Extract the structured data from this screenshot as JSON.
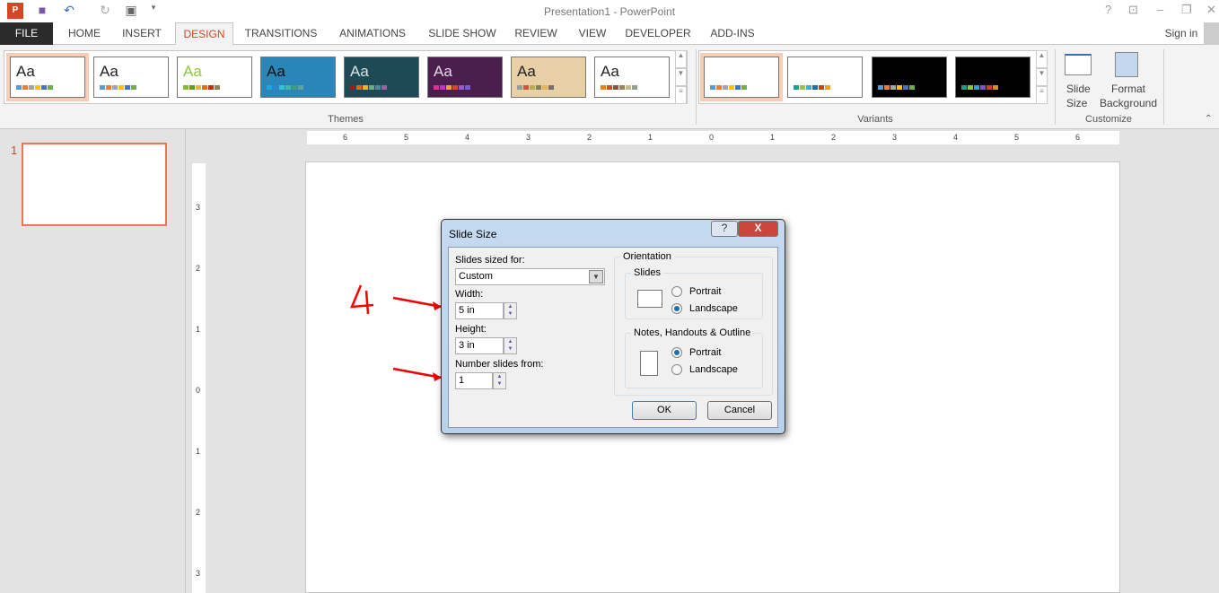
{
  "app": {
    "title": "Presentation1 - PowerPoint",
    "sign_in": "Sign in"
  },
  "tabs": [
    "FILE",
    "HOME",
    "INSERT",
    "DESIGN",
    "TRANSITIONS",
    "ANIMATIONS",
    "SLIDE SHOW",
    "REVIEW",
    "VIEW",
    "DEVELOPER",
    "ADD-INS"
  ],
  "active_tab": "DESIGN",
  "ribbon": {
    "themes_label": "Themes",
    "variants_label": "Variants",
    "customize_label": "Customize",
    "theme_sample": "Aa",
    "slide_size": "Slide Size",
    "slide_size_line1": "Slide",
    "slide_size_line2": "Size",
    "format_bg_line1": "Format",
    "format_bg_line2": "Background"
  },
  "themes": [
    {
      "bg": "#ffffff",
      "fg": "#222",
      "colors": [
        "#5b9bd5",
        "#ed7d31",
        "#a5a5a5",
        "#ffc000",
        "#4472c4",
        "#70ad47"
      ]
    },
    {
      "bg": "#ffffff",
      "fg": "#222",
      "colors": [
        "#5b9bd5",
        "#ed7d31",
        "#a5a5a5",
        "#ffc000",
        "#4472c4",
        "#70ad47"
      ]
    },
    {
      "bg": "#ffffff",
      "fg": "#8dc63f",
      "colors": [
        "#8ab833",
        "#5f9d2b",
        "#e6b91e",
        "#e76618",
        "#c42f1a",
        "#918655"
      ]
    },
    {
      "bg": "#2a86b8",
      "fg": "#111",
      "colors": [
        "#1ca5e0",
        "#2b88c8",
        "#33c3d9",
        "#47b5a5",
        "#3f9f7c",
        "#62a39f"
      ]
    },
    {
      "bg": "#1d4a55",
      "fg": "#d8e6e8",
      "colors": [
        "#b01513",
        "#ea6312",
        "#e6b729",
        "#6bab90",
        "#55839a",
        "#9e5e9b"
      ]
    },
    {
      "bg": "#4a1f4e",
      "fg": "#e8d8ea",
      "colors": [
        "#e32d91",
        "#c830cc",
        "#f0a22e",
        "#d3472b",
        "#9b57d3",
        "#755dd9"
      ]
    },
    {
      "bg": "#e8cfa6",
      "fg": "#222",
      "colors": [
        "#93a299",
        "#cf543f",
        "#b5ae53",
        "#848058",
        "#e8b54d",
        "#786c71"
      ]
    },
    {
      "bg": "#ffffff",
      "fg": "#222",
      "colors": [
        "#e48312",
        "#bd582c",
        "#865640",
        "#9b8357",
        "#c2bc80",
        "#94a088"
      ]
    }
  ],
  "variants": [
    {
      "bg": "#ffffff",
      "colors": [
        "#5b9bd5",
        "#ed7d31",
        "#a5a5a5",
        "#ffc000",
        "#4472c4",
        "#70ad47"
      ]
    },
    {
      "bg": "#ffffff",
      "colors": [
        "#1f9e89",
        "#8dc63f",
        "#33b1d5",
        "#1f6ca9",
        "#b8481e",
        "#f2a01c"
      ]
    },
    {
      "bg": "#000000",
      "colors": [
        "#5b9bd5",
        "#ed7d31",
        "#a5a5a5",
        "#ffc000",
        "#4472c4",
        "#70ad47"
      ]
    },
    {
      "bg": "#000000",
      "colors": [
        "#1f9e89",
        "#8dc63f",
        "#33a1cc",
        "#7a57c8",
        "#c8432a",
        "#dc8a2e"
      ]
    }
  ],
  "thumbnail": {
    "number": "1"
  },
  "hruler": [
    "6",
    "5",
    "4",
    "3",
    "2",
    "1",
    "0",
    "1",
    "2",
    "3",
    "4",
    "5",
    "6"
  ],
  "vruler": [
    "3",
    "2",
    "1",
    "0",
    "1",
    "2",
    "3"
  ],
  "dialog": {
    "title": "Slide Size",
    "help": "?",
    "close": "X",
    "sized_for_label": "Slides sized for:",
    "sized_for_value": "Custom",
    "width_label": "Width:",
    "width_value": "5 in",
    "height_label": "Height:",
    "height_value": "3 in",
    "number_from_label": "Number slides from:",
    "number_from_value": "1",
    "orientation_label": "Orientation",
    "slides_label": "Slides",
    "slides_portrait": "Portrait",
    "slides_landscape": "Landscape",
    "slides_selected": "Landscape",
    "notes_label": "Notes, Handouts & Outline",
    "notes_portrait": "Portrait",
    "notes_landscape": "Landscape",
    "notes_selected": "Portrait",
    "ok": "OK",
    "cancel": "Cancel"
  },
  "annotation": {
    "text": "4",
    "color": "#ff0000"
  }
}
